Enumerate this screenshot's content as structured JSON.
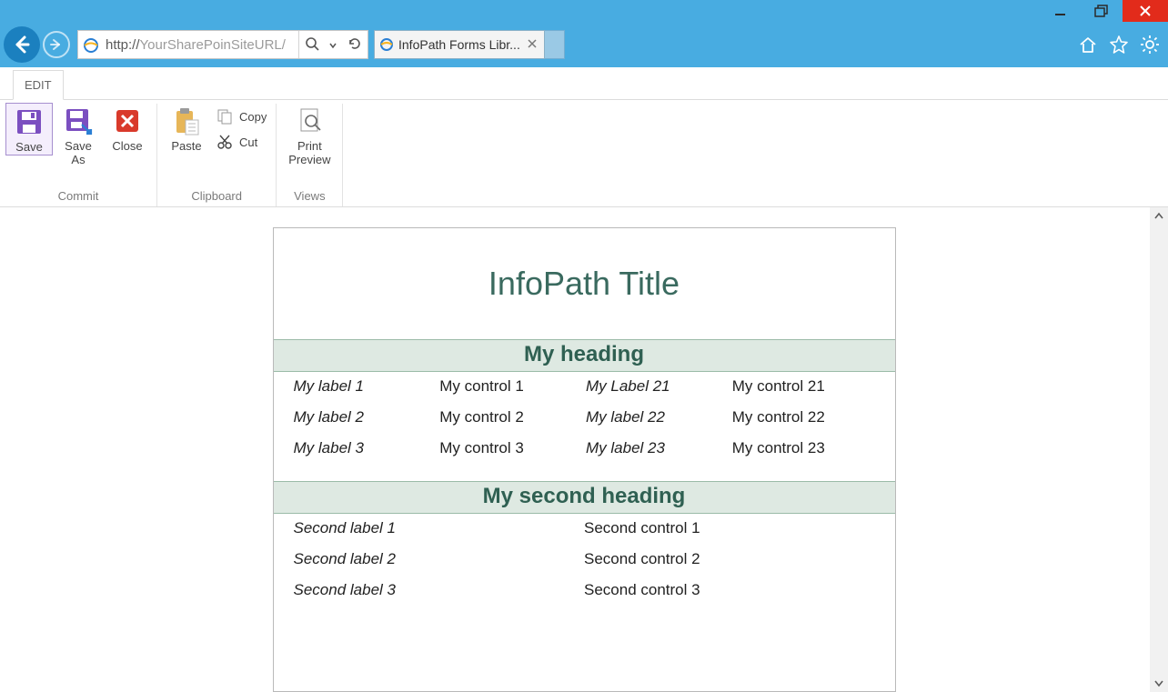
{
  "address_proto": "http://",
  "address_rest": "YourSharePoinSiteURL/",
  "tab_title": "InfoPath Forms Libr...",
  "ribbon_tab": "EDIT",
  "groups": {
    "commit": {
      "label": "Commit",
      "save": "Save",
      "save_as": "Save\nAs"
    },
    "close": "Close",
    "clipboard": {
      "label": "Clipboard",
      "paste": "Paste",
      "copy": "Copy",
      "cut": "Cut"
    },
    "views": {
      "label": "Views",
      "print_preview": "Print\nPreview"
    }
  },
  "form": {
    "title": "InfoPath Title",
    "section1": {
      "heading": "My heading",
      "rows": [
        {
          "l1": "My label 1",
          "c1": "My control 1",
          "l2": "My Label 21",
          "c2": "My control 21"
        },
        {
          "l1": "My label 2",
          "c1": "My control 2",
          "l2": "My label 22",
          "c2": "My control 22"
        },
        {
          "l1": "My label 3",
          "c1": "My control 3",
          "l2": "My label 23",
          "c2": "My control 23"
        }
      ]
    },
    "section2": {
      "heading": "My second heading",
      "rows": [
        {
          "l": "Second label 1",
          "c": "Second control 1"
        },
        {
          "l": "Second label 2",
          "c": "Second control 2"
        },
        {
          "l": "Second label 3",
          "c": "Second control 3"
        }
      ]
    }
  }
}
